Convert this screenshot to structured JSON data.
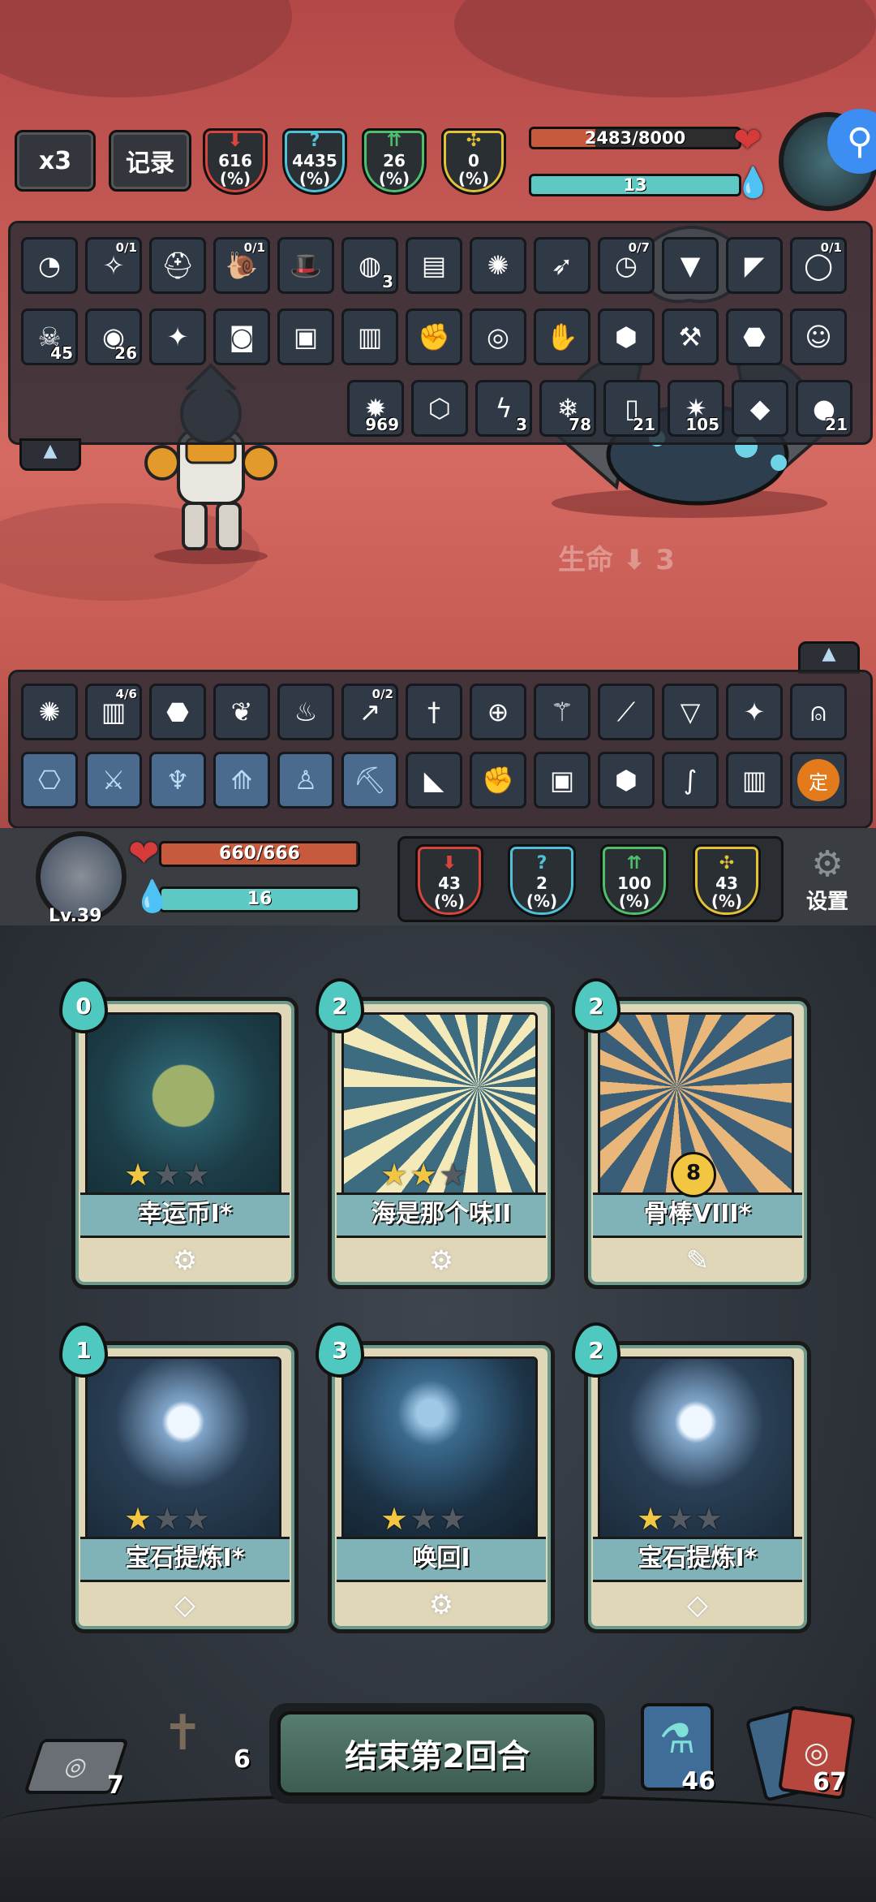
{
  "top": {
    "speed_label": "x3",
    "log_label": "记录",
    "enemy_stats": [
      {
        "value": "616",
        "unit": "(%)",
        "color": "#d8453c",
        "icon": "attack-icon"
      },
      {
        "value": "4435",
        "unit": "(%)",
        "color": "#4fc1d8",
        "icon": "question-icon"
      },
      {
        "value": "26",
        "unit": "(%)",
        "color": "#4fbf6a",
        "icon": "defense-icon"
      },
      {
        "value": "0",
        "unit": "(%)",
        "color": "#e3c23a",
        "icon": "crit-icon"
      }
    ],
    "enemy_hp": "2483/8000",
    "enemy_hp_fraction": 0.31,
    "enemy_energy": "13",
    "enemy_energy_fraction": 1.0
  },
  "enemy_relics_row1": [
    {
      "icon": "goggles-icon",
      "count": ""
    },
    {
      "icon": "claw-icon",
      "count": "",
      "frac": "0/1"
    },
    {
      "icon": "helmet-icon",
      "count": ""
    },
    {
      "icon": "snail-icon",
      "count": "",
      "frac": "0/1"
    },
    {
      "icon": "hat-icon",
      "count": ""
    },
    {
      "icon": "orb-icon",
      "count": "3"
    },
    {
      "icon": "book-icon",
      "count": ""
    },
    {
      "icon": "bug-icon",
      "count": ""
    },
    {
      "icon": "arrows-icon",
      "count": ""
    },
    {
      "icon": "clock-icon",
      "count": "",
      "frac": "0/7"
    },
    {
      "icon": "drill-icon",
      "count": ""
    },
    {
      "icon": "fan-icon",
      "count": ""
    },
    {
      "icon": "ring-icon",
      "count": "",
      "frac": "0/1"
    }
  ],
  "enemy_relics_row2": [
    {
      "icon": "poison-skull-icon",
      "count": "45"
    },
    {
      "icon": "vortex-icon",
      "count": "26"
    },
    {
      "icon": "bird-icon",
      "count": ""
    },
    {
      "icon": "robot-icon",
      "count": ""
    },
    {
      "icon": "golem-icon",
      "count": ""
    },
    {
      "icon": "scroll-icon",
      "count": ""
    },
    {
      "icon": "fist-icon",
      "count": ""
    },
    {
      "icon": "shell-icon",
      "count": ""
    },
    {
      "icon": "glove-icon",
      "count": ""
    },
    {
      "icon": "shield-icon",
      "count": ""
    },
    {
      "icon": "hammer-icon",
      "count": ""
    },
    {
      "icon": "beetle-icon",
      "count": ""
    },
    {
      "icon": "ghost-icon",
      "count": ""
    }
  ],
  "enemy_effects": [
    {
      "icon": "burn-icon",
      "count": "969"
    },
    {
      "icon": "turtle-shell-icon",
      "count": ""
    },
    {
      "icon": "lightning-icon",
      "count": "3"
    },
    {
      "icon": "frost-icon",
      "count": "78"
    },
    {
      "icon": "paper-icon",
      "count": "21"
    },
    {
      "icon": "curse-icon",
      "count": "105"
    },
    {
      "icon": "crystal-icon",
      "count": ""
    },
    {
      "icon": "stone-icon",
      "count": "21"
    }
  ],
  "floating_text": "生命",
  "floating_value": "3",
  "player_relics_row1": [
    {
      "icon": "bug-icon",
      "count": ""
    },
    {
      "icon": "scroll-icon",
      "count": "",
      "frac": "4/6"
    },
    {
      "icon": "beetle-icon",
      "count": ""
    },
    {
      "icon": "wings-icon",
      "count": ""
    },
    {
      "icon": "gourd-icon",
      "count": ""
    },
    {
      "icon": "blade-icon",
      "count": "",
      "frac": "0/2"
    },
    {
      "icon": "dagger-icon",
      "count": ""
    },
    {
      "icon": "compass-icon",
      "count": ""
    },
    {
      "icon": "staff-icon",
      "count": ""
    },
    {
      "icon": "stick-icon",
      "count": ""
    },
    {
      "icon": "ice-cream-icon",
      "count": ""
    },
    {
      "icon": "bird-icon",
      "count": ""
    },
    {
      "icon": "knight-helmet-icon",
      "count": ""
    }
  ],
  "player_relics_row2": [
    {
      "icon": "blue-rune-icon",
      "count": ""
    },
    {
      "icon": "blue-sword-icon",
      "count": ""
    },
    {
      "icon": "blue-flame-icon",
      "count": ""
    },
    {
      "icon": "blue-claws-icon",
      "count": ""
    },
    {
      "icon": "blue-figure-icon",
      "count": ""
    },
    {
      "icon": "blue-pickaxe-icon",
      "count": ""
    },
    {
      "icon": "shoe-icon",
      "count": ""
    },
    {
      "icon": "fist-icon",
      "count": ""
    },
    {
      "icon": "golem-icon",
      "count": ""
    },
    {
      "icon": "shield-icon",
      "count": ""
    },
    {
      "icon": "swan-icon",
      "count": ""
    },
    {
      "icon": "scroll-icon",
      "count": ""
    },
    {
      "icon": "fixed-orb-icon",
      "count": "",
      "label": "定"
    }
  ],
  "player": {
    "level": "Lv.39",
    "hp": "660/666",
    "hp_fraction": 0.99,
    "energy": "16",
    "energy_fraction": 1.0,
    "stats": [
      {
        "value": "43",
        "unit": "(%)",
        "color": "#d8453c",
        "icon": "attack-icon"
      },
      {
        "value": "2",
        "unit": "(%)",
        "color": "#4fc1d8",
        "icon": "question-icon"
      },
      {
        "value": "100",
        "unit": "(%)",
        "color": "#4fbf6a",
        "icon": "defense-icon"
      },
      {
        "value": "43",
        "unit": "(%)",
        "color": "#e3c23a",
        "icon": "crit-icon"
      }
    ],
    "settings_label": "设置"
  },
  "cards": [
    {
      "cost": "0",
      "name": "幸运币I*",
      "stars": 1,
      "footer_icon": "gear-icon",
      "art": "coin-art"
    },
    {
      "cost": "2",
      "name": "海是那个味II",
      "stars": 2,
      "footer_icon": "gear-icon",
      "art": "peek-art"
    },
    {
      "cost": "2",
      "name": "骨棒VIII*",
      "stars": 0,
      "badge": "8",
      "footer_icon": "claw-icon",
      "art": "bone-art"
    },
    {
      "cost": "1",
      "name": "宝石提炼I*",
      "stars": 1,
      "footer_icon": "diamond-icon",
      "art": "crystal-hand-art"
    },
    {
      "cost": "3",
      "name": "唤回I",
      "stars": 1,
      "footer_icon": "gear-icon",
      "art": "hand-art"
    },
    {
      "cost": "2",
      "name": "宝石提炼I*",
      "stars": 1,
      "footer_icon": "diamond-icon",
      "art": "crystal-hand-art"
    }
  ],
  "bottom": {
    "draw_pile": "7",
    "graveyard": "6",
    "end_turn_label": "结束第2回合",
    "potion_count": "46",
    "deck_count": "67"
  }
}
